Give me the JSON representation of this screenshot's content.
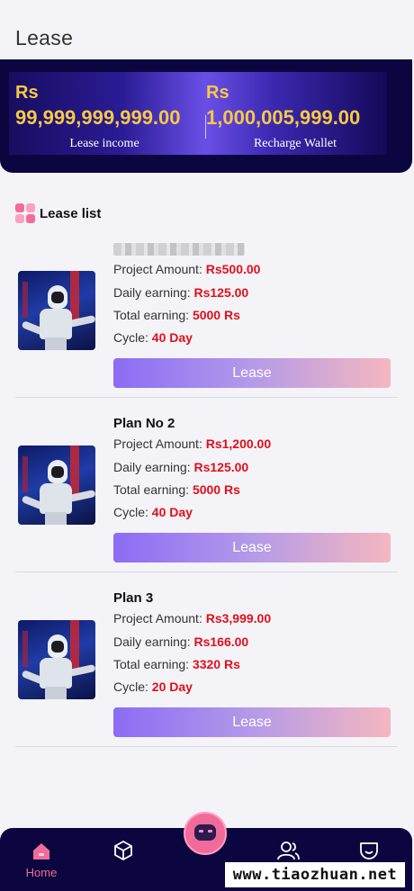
{
  "header": {
    "title": "Lease"
  },
  "wallet": {
    "income": {
      "currency": "Rs",
      "amount": "99,999,999,999.00",
      "label": "Lease income"
    },
    "recharge": {
      "currency": "Rs",
      "amount": "1,000,005,999.00",
      "label": "Recharge Wallet"
    }
  },
  "section": {
    "title": "Lease list"
  },
  "labels": {
    "project_amount": "Project Amount: ",
    "daily_earning": "Daily earning: ",
    "total_earning": "Total earning: ",
    "cycle": "Cycle: ",
    "button": "Lease"
  },
  "plans": [
    {
      "name": "",
      "amount": "Rs500.00",
      "daily": "Rs125.00",
      "total": "5000 Rs",
      "cycle": "40 Day"
    },
    {
      "name": "Plan No 2",
      "amount": "Rs1,200.00",
      "daily": "Rs125.00",
      "total": "5000 Rs",
      "cycle": "40 Day"
    },
    {
      "name": "Plan 3",
      "amount": "Rs3,999.00",
      "daily": "Rs166.00",
      "total": "3320 Rs",
      "cycle": "20 Day"
    }
  ],
  "tabbar": {
    "home": "Home",
    "icons": [
      "home-icon",
      "box-icon",
      "robot-icon",
      "users-icon",
      "profile-icon"
    ]
  },
  "watermark": "www.tiaozhuan.net",
  "colors": {
    "accent": "#f26c9a",
    "value": "#e0101a",
    "wallet_text": "#f7c845",
    "nav_bg": "#0c0640"
  }
}
